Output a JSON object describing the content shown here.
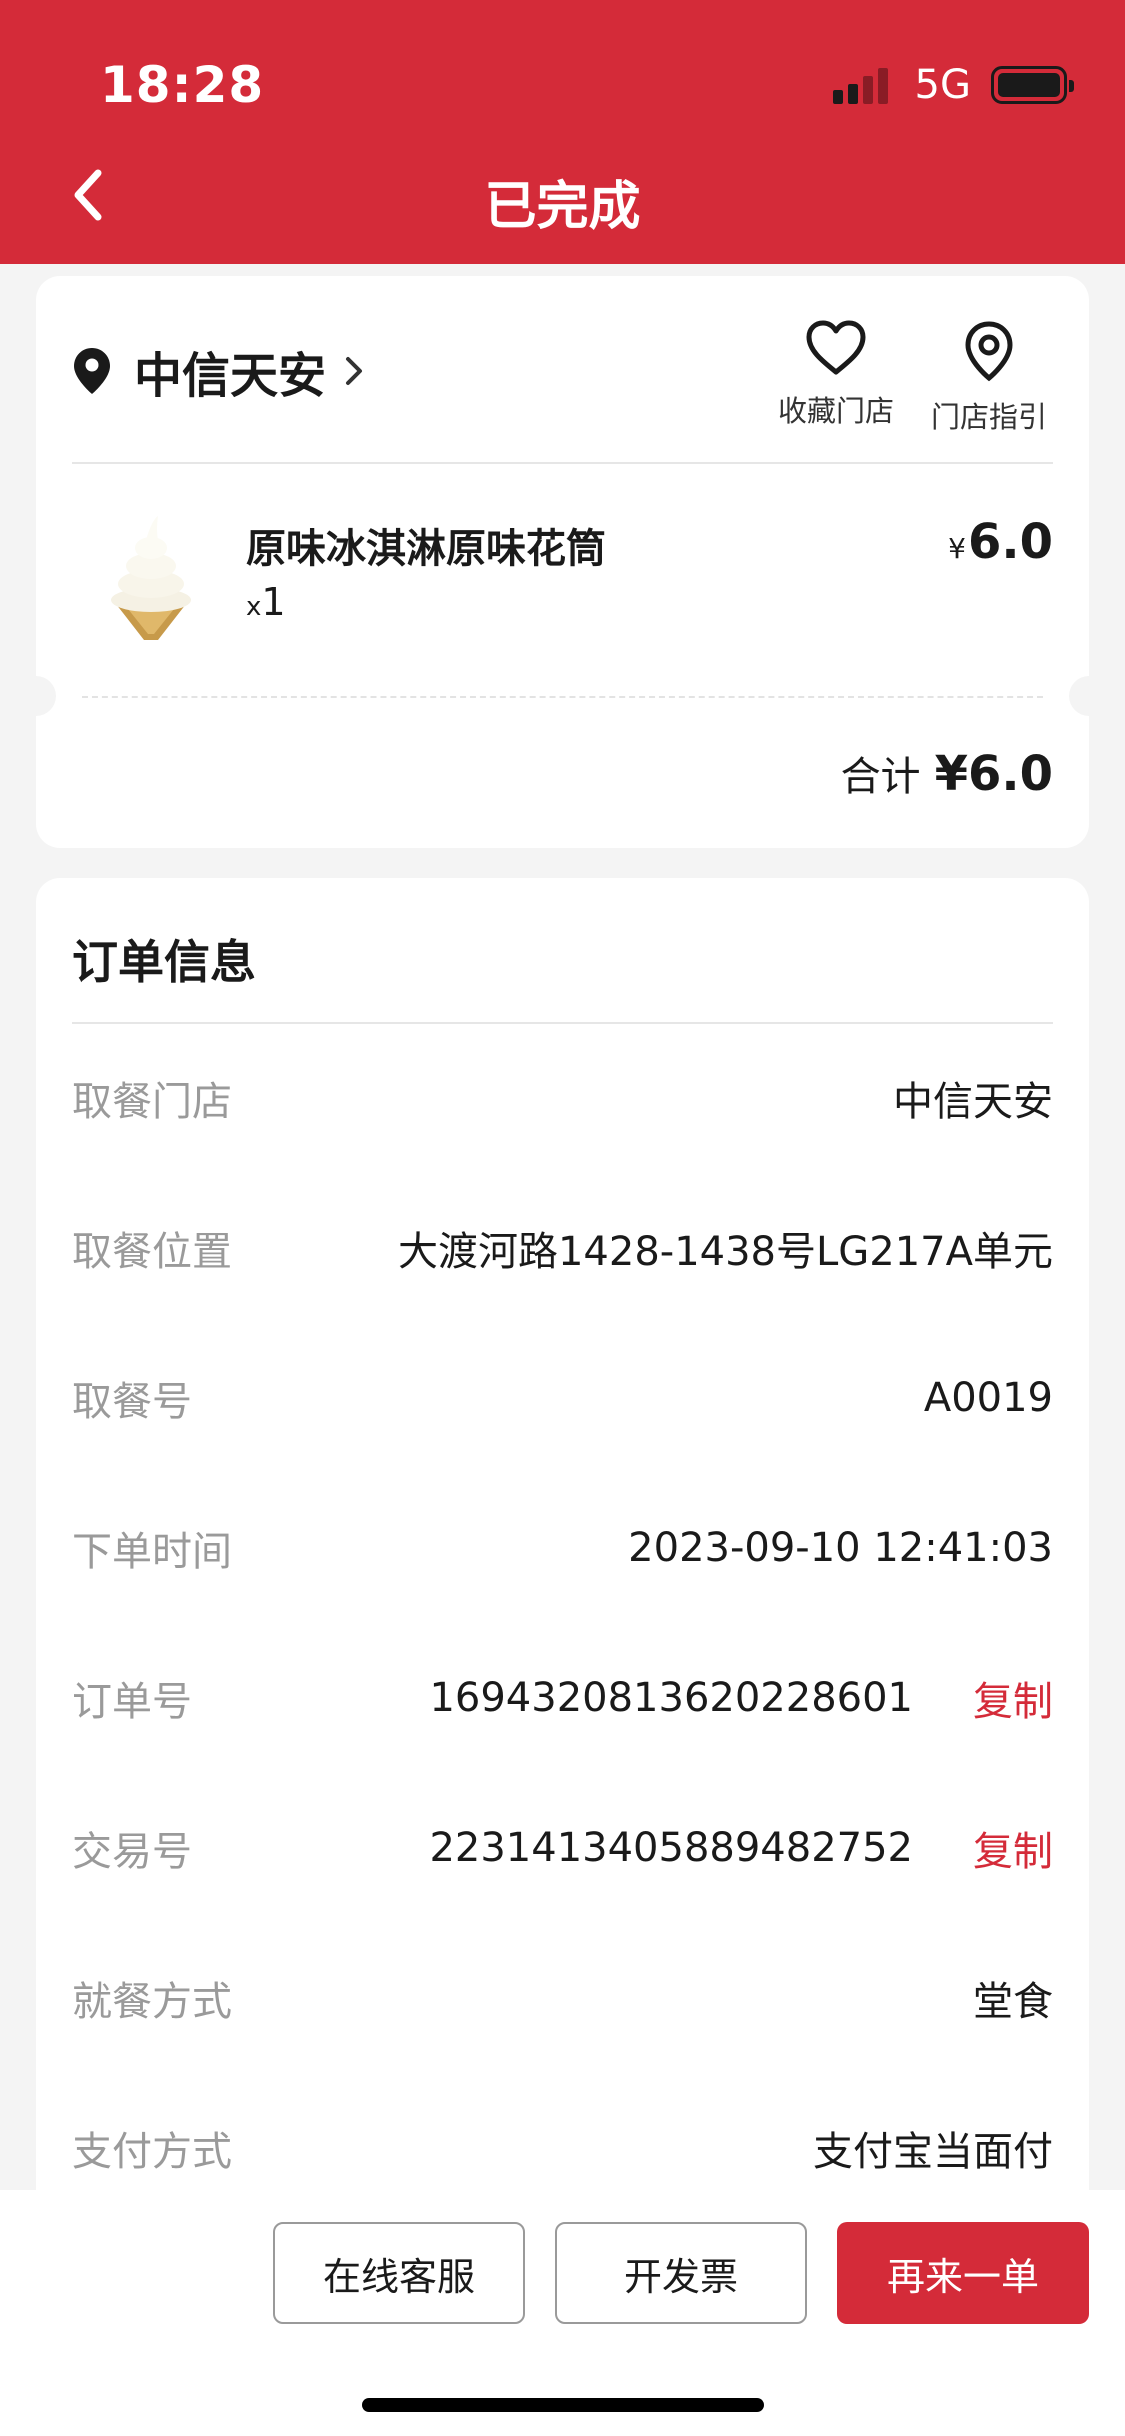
{
  "status_bar": {
    "time": "18:28",
    "network": "5G"
  },
  "header": {
    "title": "已完成"
  },
  "store": {
    "name": "中信天安",
    "favorite_label": "收藏门店",
    "guide_label": "门店指引"
  },
  "product": {
    "name": "原味冰淇淋原味花筒",
    "qty_prefix": "x",
    "qty": "1",
    "currency": "¥",
    "price": "6.0"
  },
  "total": {
    "label": "合计",
    "amount": "¥6.0"
  },
  "order_info": {
    "title": "订单信息",
    "rows": [
      {
        "label": "取餐门店",
        "value": "中信天安"
      },
      {
        "label": "取餐位置",
        "value": "大渡河路1428-1438号LG217A单元"
      },
      {
        "label": "取餐号",
        "value": "A0019"
      },
      {
        "label": "下单时间",
        "value": "2023-09-10 12:41:03"
      },
      {
        "label": "订单号",
        "value": "1694320813620228601",
        "action": "复制"
      },
      {
        "label": "交易号",
        "value": "2231413405889482752",
        "action": "复制"
      },
      {
        "label": "就餐方式",
        "value": "堂食"
      },
      {
        "label": "支付方式",
        "value": "支付宝当面付"
      }
    ]
  },
  "actions": {
    "customer_service": "在线客服",
    "invoice": "开发票",
    "reorder": "再来一单"
  },
  "colors": {
    "brand_red": "#d42b39",
    "label_gray": "#9a9a9a",
    "background": "#f4f4f4"
  }
}
